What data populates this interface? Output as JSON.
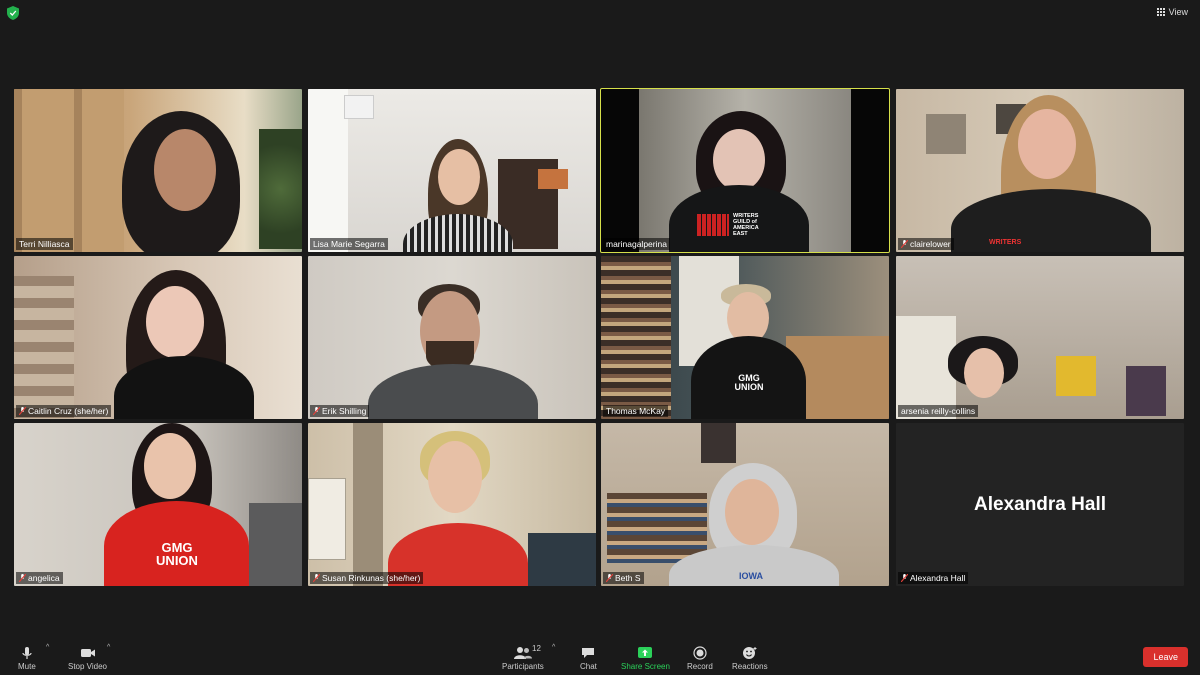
{
  "topbar": {
    "view_label": "View"
  },
  "participants": [
    {
      "name": "Terri Nilliasca",
      "muted": false,
      "active": false,
      "video": true
    },
    {
      "name": "Lisa Marie Segarra",
      "muted": false,
      "active": false,
      "video": true
    },
    {
      "name": "marinagalperina",
      "muted": false,
      "active": true,
      "video": true
    },
    {
      "name": "clairelower",
      "muted": true,
      "active": false,
      "video": true
    },
    {
      "name": "Caitlin Cruz (she/her)",
      "muted": true,
      "active": false,
      "video": true
    },
    {
      "name": "Erik Shilling",
      "muted": true,
      "active": false,
      "video": true
    },
    {
      "name": "Thomas McKay",
      "muted": false,
      "active": false,
      "video": true
    },
    {
      "name": "arsenia reilly-collins",
      "muted": false,
      "active": false,
      "video": true
    },
    {
      "name": "angelica",
      "muted": true,
      "active": false,
      "video": true
    },
    {
      "name": "Susan Rinkunas (she/her)",
      "muted": true,
      "active": false,
      "video": true
    },
    {
      "name": "Beth S",
      "muted": true,
      "active": false,
      "video": true
    },
    {
      "name": "Alexandra Hall",
      "muted": true,
      "active": false,
      "video": false
    }
  ],
  "shirt_text": {
    "wga": "WRITERS GUILD of AMERICA EAST",
    "gmg": "GMG UNION",
    "writers": "WRITERS",
    "iowa": "IOWA"
  },
  "toolbar": {
    "mute": "Mute",
    "stop_video": "Stop Video",
    "participants": "Participants",
    "participants_count": "12",
    "chat": "Chat",
    "share_screen": "Share Screen",
    "record": "Record",
    "reactions": "Reactions",
    "leave": "Leave"
  },
  "colors": {
    "active_border": "#d6e04a",
    "share_green": "#2bd15a",
    "leave_red": "#d9302c",
    "muted_red": "#e0403a"
  }
}
